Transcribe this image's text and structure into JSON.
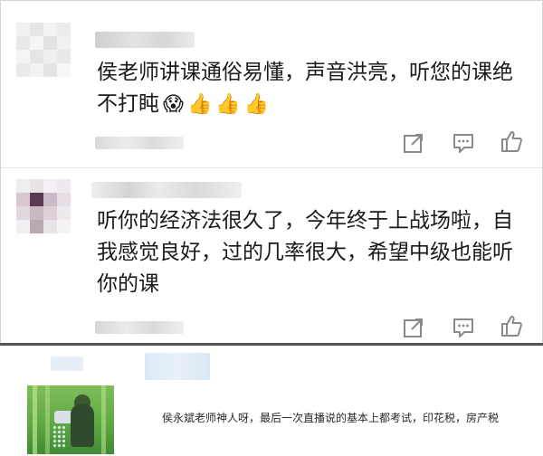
{
  "comments": [
    {
      "text": "侯老师讲课通俗易懂，声音洪亮，听您的课绝不打盹",
      "emojis": [
        "😱",
        "👍",
        "👍",
        "👍"
      ],
      "actions": {
        "share_icon": "share-icon",
        "reply_icon": "reply-icon",
        "like_icon": "like-icon"
      }
    },
    {
      "text": "听你的经济法很久了，今年终于上战场啦，自我感觉良好，过的几率很大，希望中级也能听你的课",
      "actions": {
        "share_icon": "share-icon",
        "reply_icon": "reply-icon",
        "like_icon": "like-icon"
      }
    }
  ],
  "post": {
    "caption": "侯永斌老师神人呀，最后一次直播说的基本上都考试，印花税，房产税"
  },
  "colors": {
    "text": "#1a1a1a",
    "icon": "#8a8a8a",
    "border": "#d4d4d4",
    "thumb_green": "#5fa844"
  }
}
